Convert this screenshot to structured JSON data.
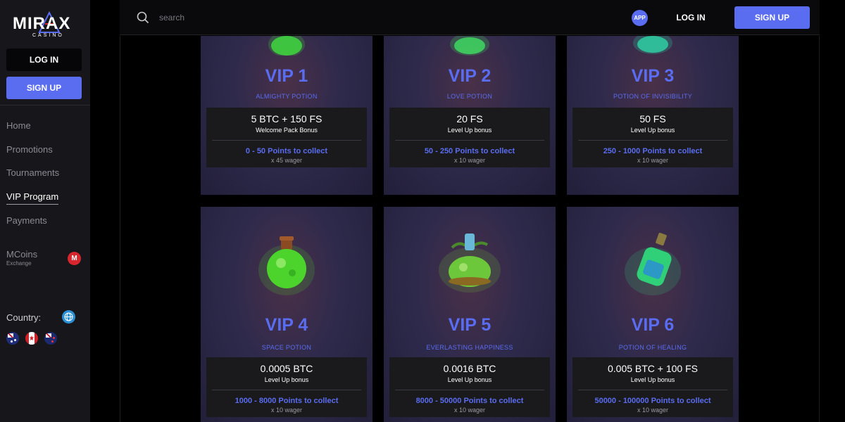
{
  "brand": {
    "name": "MIRAX",
    "sub": "CASINO"
  },
  "sidebar": {
    "login_label": "LOG IN",
    "signup_label": "SIGN UP",
    "nav": [
      "Home",
      "Promotions",
      "Tournaments",
      "VIP Program",
      "Payments"
    ],
    "active": "VIP Program",
    "mcoins": {
      "label": "MCoins",
      "sub": "Exchange",
      "badge": "M"
    },
    "country_label": "Country:",
    "flags": [
      "australia-flag",
      "canada-flag",
      "new-zealand-flag"
    ]
  },
  "topbar": {
    "search_placeholder": "search",
    "app_label": "APP",
    "login_label": "LOG IN",
    "signup_label": "SIGN UP"
  },
  "vip_levels": [
    {
      "title": "VIP 1",
      "name": "ALMIGHTY POTION",
      "bonus": "5 BTC + 150 FS",
      "bonus_label": "Welcome Pack Bonus",
      "points": "0 - 50 Points to collect",
      "wager": "x 45 wager",
      "potion_color": "#3fd040"
    },
    {
      "title": "VIP 2",
      "name": "LOVE POTION",
      "bonus": "20 FS",
      "bonus_label": "Level Up bonus",
      "points": "50 - 250 Points to collect",
      "wager": "x 10 wager",
      "potion_color": "#3fd060"
    },
    {
      "title": "VIP 3",
      "name": "POTION OF INVISIBILITY",
      "bonus": "50 FS",
      "bonus_label": "Level Up bonus",
      "points": "250 - 1000 Points to collect",
      "wager": "x 10 wager",
      "potion_color": "#2fc8a0"
    },
    {
      "title": "VIP 4",
      "name": "SPACE POTION",
      "bonus": "0.0005 BTC",
      "bonus_label": "Level Up bonus",
      "points": "1000 - 8000 Points to collect",
      "wager": "x 10 wager",
      "potion_color": "#4cd42c"
    },
    {
      "title": "VIP 5",
      "name": "EVERLASTING HAPPINESS",
      "bonus": "0.0016 BTC",
      "bonus_label": "Level Up bonus",
      "points": "8000 - 50000 Points to collect",
      "wager": "x 10 wager",
      "potion_color": "#6cc83a"
    },
    {
      "title": "VIP 6",
      "name": "POTION OF HEALING",
      "bonus": "0.005 BTC + 100 FS",
      "bonus_label": "Level Up bonus",
      "points": "50000 - 100000 Points to collect",
      "wager": "x 10 wager",
      "potion_color": "#2fd078"
    }
  ],
  "colors": {
    "accent": "#5a6cf0",
    "sidebar_bg": "#17171b",
    "card_bg": "#2e2a4c"
  }
}
